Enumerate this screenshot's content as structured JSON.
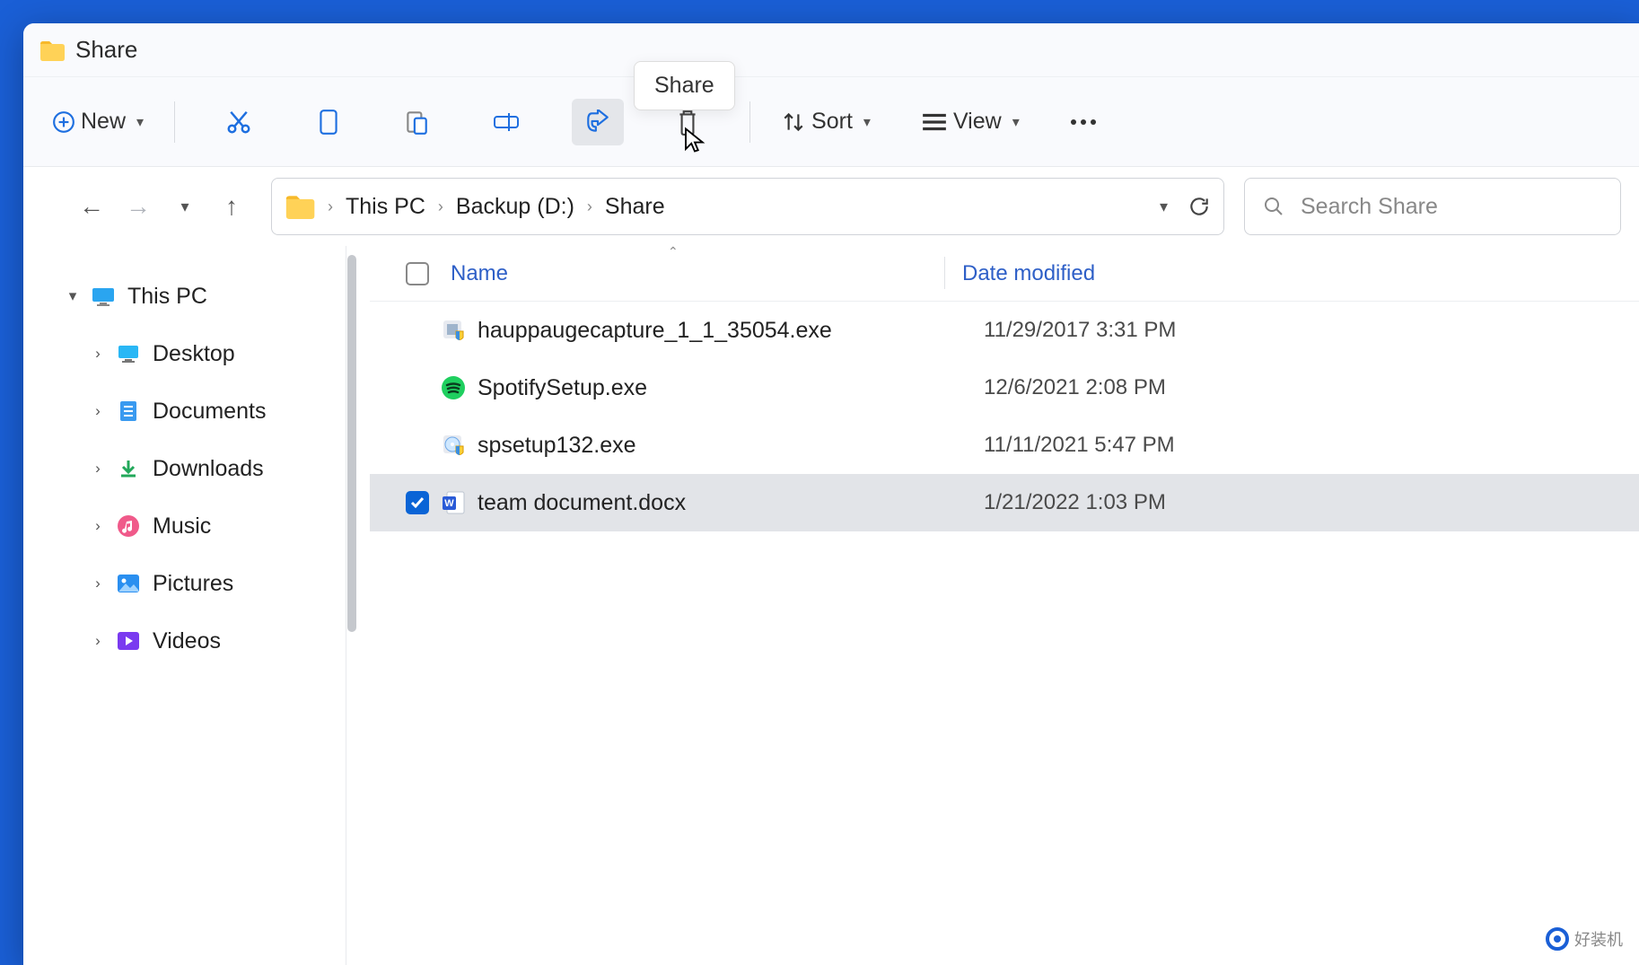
{
  "title": "Share",
  "tooltip": "Share",
  "toolbar": {
    "new": "New",
    "sort": "Sort",
    "view": "View"
  },
  "breadcrumbs": [
    "This PC",
    "Backup (D:)",
    "Share"
  ],
  "search_placeholder": "Search Share",
  "sidebar": {
    "root": "This PC",
    "items": [
      "Desktop",
      "Documents",
      "Downloads",
      "Music",
      "Pictures",
      "Videos"
    ]
  },
  "columns": {
    "name": "Name",
    "date": "Date modified"
  },
  "files": [
    {
      "name": "hauppaugecapture_1_1_35054.exe",
      "date": "11/29/2017 3:31 PM",
      "icon": "exe-shield",
      "selected": false
    },
    {
      "name": "SpotifySetup.exe",
      "date": "12/6/2021 2:08 PM",
      "icon": "spotify",
      "selected": false
    },
    {
      "name": "spsetup132.exe",
      "date": "11/11/2021 5:47 PM",
      "icon": "disc-shield",
      "selected": false
    },
    {
      "name": "team document.docx",
      "date": "1/21/2022 1:03 PM",
      "icon": "word",
      "selected": true
    }
  ],
  "watermark": "好装机"
}
